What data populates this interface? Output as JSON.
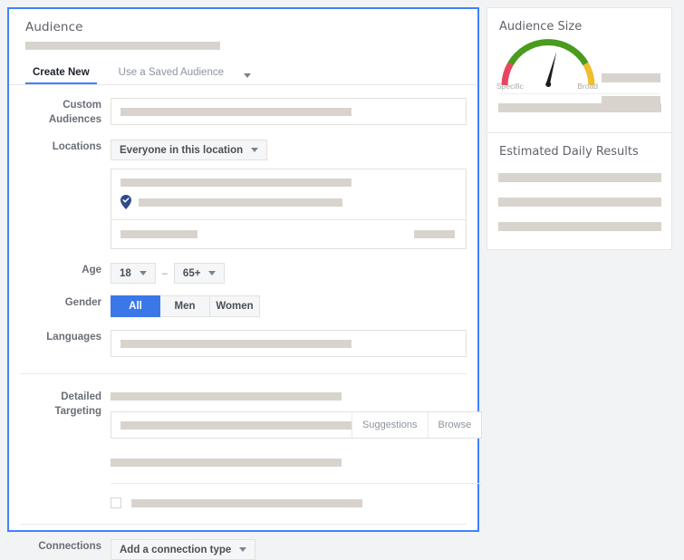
{
  "colors": {
    "accent_blue": "#4080ff",
    "selected_blue": "#3b78e7",
    "redact_gray": "#d8d4cd",
    "page_bg": "#f2f3f5",
    "gauge_red": "#e8455f",
    "gauge_green": "#4a9b1f",
    "gauge_yellow": "#f0bd2c",
    "pin_blue": "#2e4a8c"
  },
  "audience_panel": {
    "title": "Audience",
    "tabs": [
      {
        "label": "Create New",
        "active": true
      },
      {
        "label": "Use a Saved Audience",
        "active": false
      }
    ],
    "saved_audience_caret": "chevron-down-icon",
    "rows": {
      "custom_audiences": {
        "label": "Custom Audiences"
      },
      "locations": {
        "label": "Locations",
        "dropdown_value": "Everyone in this location",
        "pin_icon": "map-pin-check-icon"
      },
      "age": {
        "label": "Age",
        "min_value": "18",
        "max_value": "65+",
        "separator": "–"
      },
      "gender": {
        "label": "Gender",
        "options": [
          {
            "label": "All",
            "selected": true
          },
          {
            "label": "Men",
            "selected": false
          },
          {
            "label": "Women",
            "selected": false
          }
        ]
      },
      "languages": {
        "label": "Languages"
      },
      "detailed_targeting": {
        "label": "Detailed Targeting",
        "suggestions_label": "Suggestions",
        "browse_label": "Browse"
      },
      "connections": {
        "label": "Connections",
        "dropdown_value": "Add a connection type"
      }
    }
  },
  "audience_size_card": {
    "title": "Audience Size",
    "gauge": {
      "left_label": "Specific",
      "right_label": "Broad",
      "needle_angle_deg": 15
    }
  },
  "daily_results_card": {
    "title": "Estimated Daily Results"
  }
}
